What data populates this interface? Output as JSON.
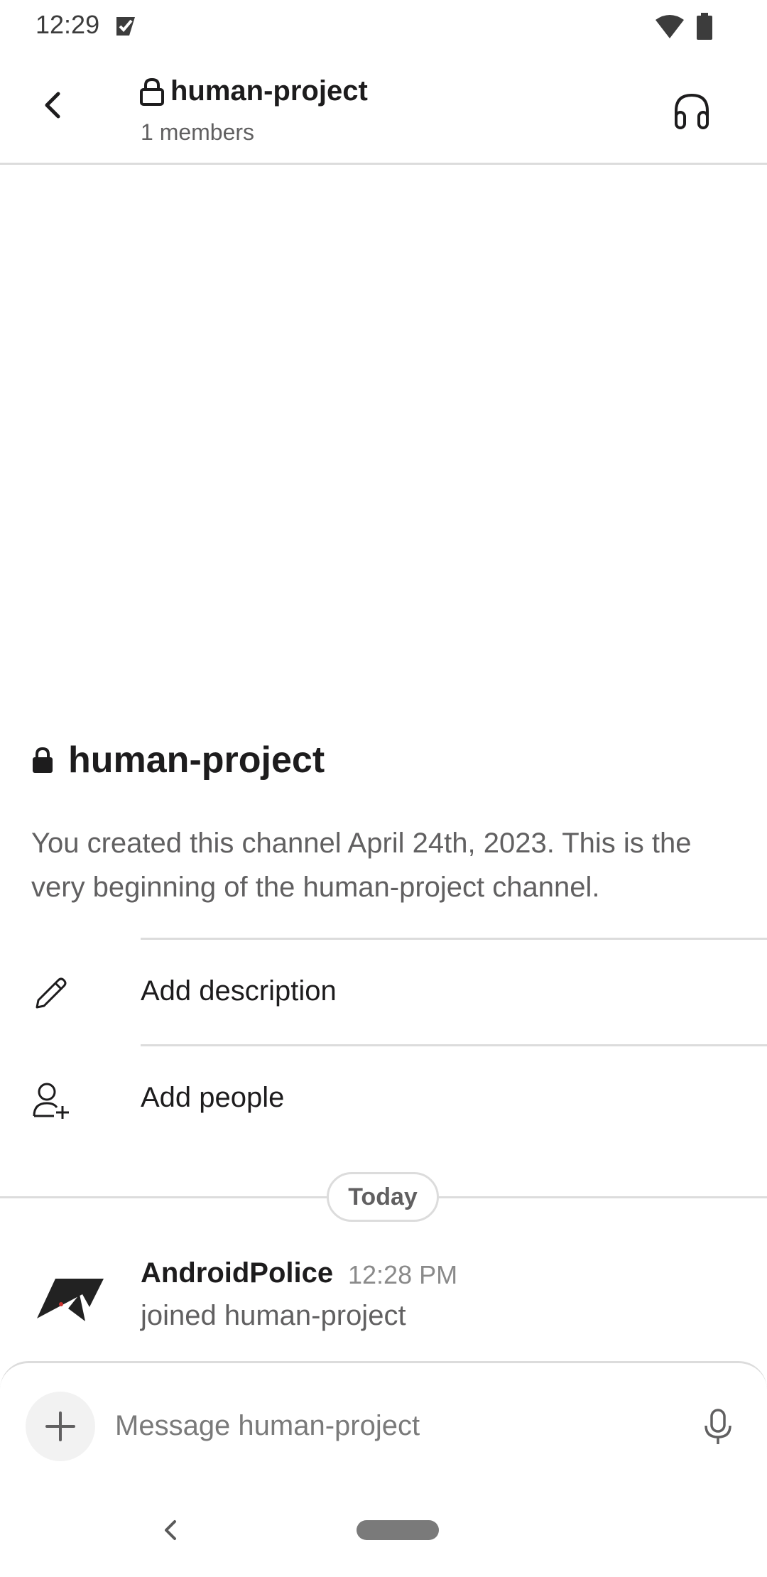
{
  "status_bar": {
    "time": "12:29"
  },
  "header": {
    "channel_name": "human-project",
    "member_count": "1 members"
  },
  "intro": {
    "channel_name": "human-project",
    "description": "You created this channel April 24th, 2023. This is the very beginning of the human-project channel."
  },
  "actions": [
    {
      "label": "Add description",
      "icon": "pencil-icon"
    },
    {
      "label": "Add people",
      "icon": "add-person-icon"
    }
  ],
  "day_divider": "Today",
  "message": {
    "author": "AndroidPolice",
    "time": "12:28 PM",
    "text": "joined human-project"
  },
  "composer": {
    "placeholder": "Message human-project"
  },
  "colors": {
    "text_primary": "#1d1c1d",
    "text_secondary": "#616061",
    "divider": "#dcdcdc"
  }
}
